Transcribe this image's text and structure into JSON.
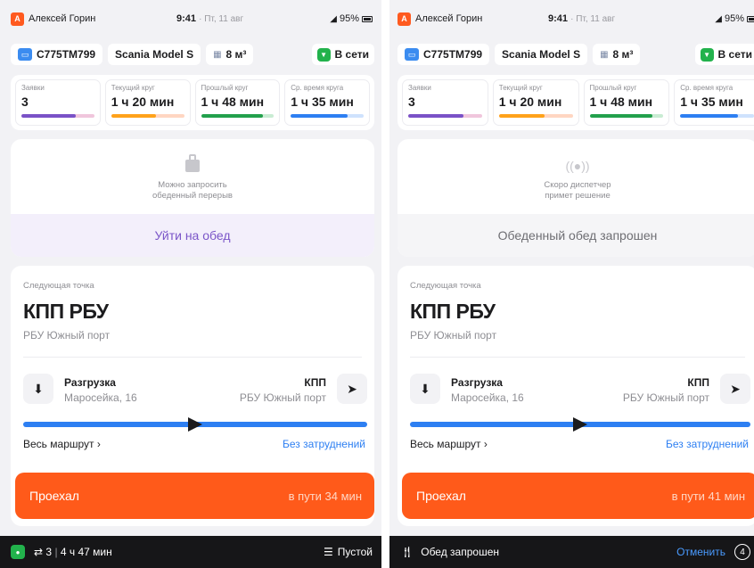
{
  "status": {
    "user_initial": "А",
    "user_name": "Алексей Горин",
    "time": "9:41",
    "date": "· Пт, 11 авг",
    "battery_left": "95%",
    "battery_right": "95%"
  },
  "vehicle": {
    "plate": "С775ТМ799",
    "model": "Scania Model S",
    "volume": "8 м³",
    "online_label": "В сети"
  },
  "stats": [
    {
      "label": "Заявки",
      "value": "3",
      "progress": 0.75,
      "color": "#7a52c7",
      "track": "#f0c6dc"
    },
    {
      "label": "Текущий круг",
      "value": "1 ч 20 мин",
      "progress": 0.62,
      "color": "#ffa21a",
      "track": "#ffd6c2"
    },
    {
      "label": "Прошлый круг",
      "value": "1 ч 48 мин",
      "progress": 0.85,
      "color": "#22a04c",
      "track": "#c9ecd3"
    },
    {
      "label": "Ср. время круга",
      "value": "1 ч 35 мин",
      "progress": 0.78,
      "color": "#2d7ff2",
      "track": "#cfe2fd"
    }
  ],
  "left": {
    "lunch_msg_1": "Можно запросить",
    "lunch_msg_2": "обеденный перерыв",
    "lunch_action": "Уйти на обед",
    "eta": "в пути 34 мин",
    "rounds": "3",
    "duration": "4 ч 47 мин",
    "load_status": "Пустой"
  },
  "right": {
    "lunch_msg_1": "Скоро диспетчер",
    "lunch_msg_2": "примет решение",
    "lunch_action": "Обеденный обед запрошен",
    "eta": "в пути 41 мин",
    "bottom_label": "Обед запрошен",
    "cancel_label": "Отменить",
    "count": "4"
  },
  "route": {
    "next_label": "Следующая точка",
    "title": "КПП РБУ",
    "subtitle": "РБУ Южный порт",
    "from_title": "Разгрузка",
    "from_address": "Маросейка, 16",
    "to_title": "КПП",
    "to_address": "РБУ Южный порт",
    "progress": 0.5,
    "all_route": "Весь маршрут ›",
    "traffic": "Без затруднений",
    "passed_label": "Проехал"
  }
}
